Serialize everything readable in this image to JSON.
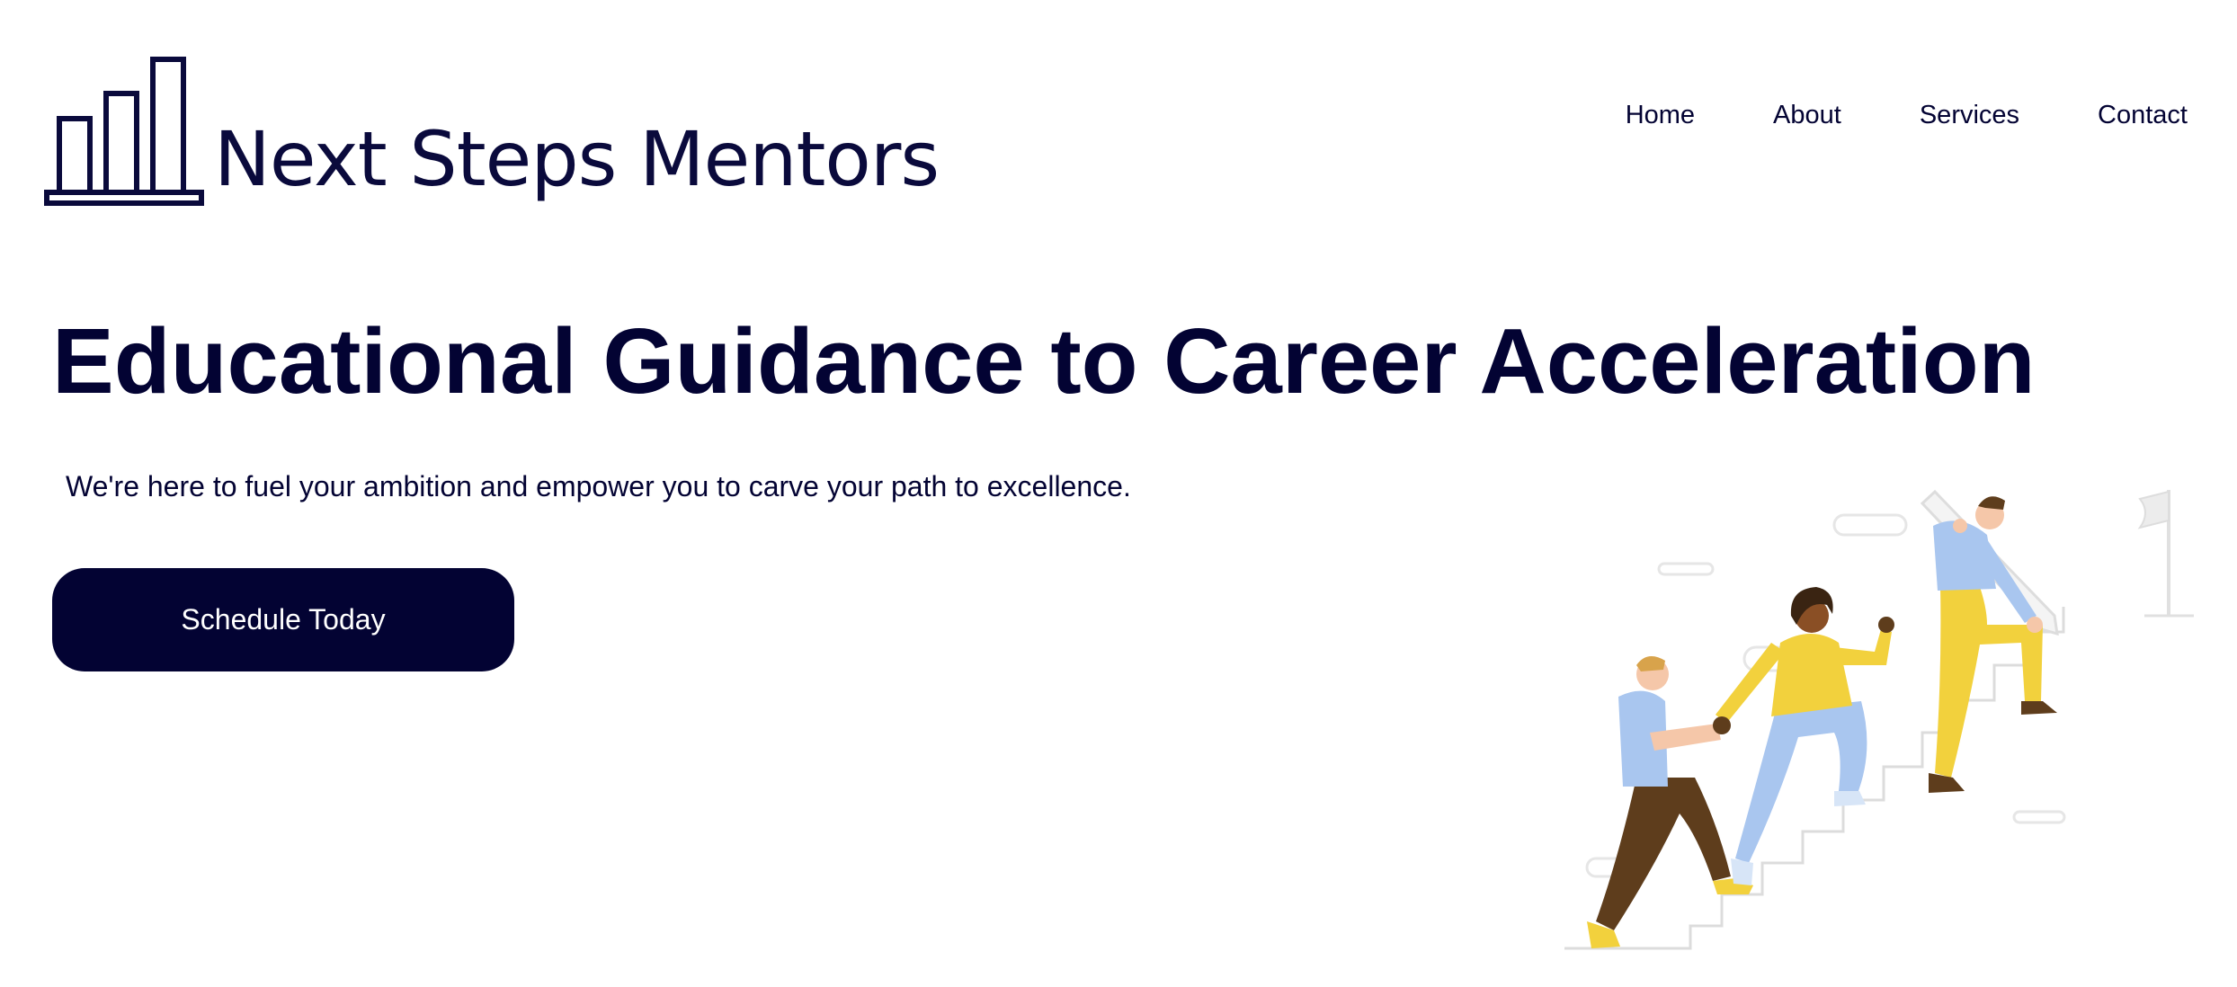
{
  "brand": {
    "name": "Next Steps Mentors",
    "logo_icon": "bar-chart-steps-icon",
    "color": "#0a0a3c"
  },
  "nav": {
    "items": [
      {
        "label": "Home"
      },
      {
        "label": "About"
      },
      {
        "label": "Services"
      },
      {
        "label": "Contact"
      }
    ]
  },
  "hero": {
    "title": "Educational Guidance to Career Acceleration",
    "subtitle": "We're here to fuel your ambition and empower you to carve your path to excellence.",
    "cta_label": "Schedule Today",
    "illustration": "people-climbing-stairs-illustration"
  },
  "colors": {
    "primary": "#030333",
    "button_text": "#ffffff",
    "background": "#ffffff",
    "accent_yellow": "#f2d13d",
    "accent_blue": "#a9c6ef",
    "accent_brown": "#5e3d1c"
  }
}
